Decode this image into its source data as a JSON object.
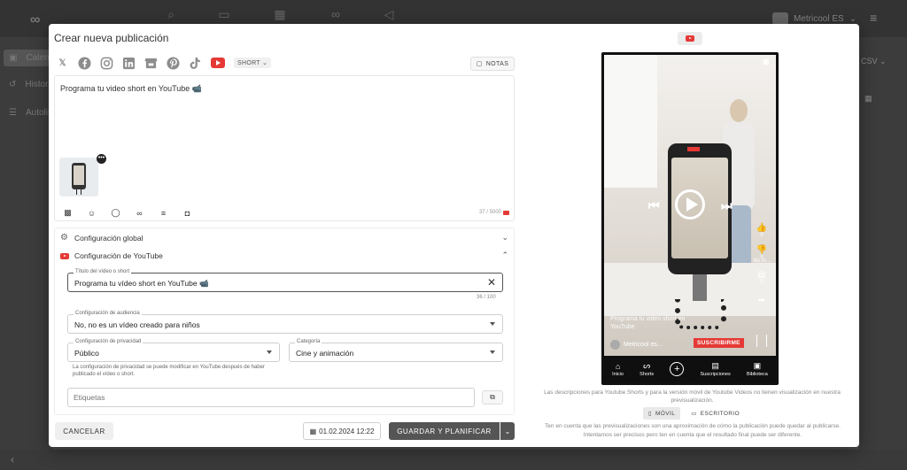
{
  "background": {
    "brand_label": "Metricool ES",
    "sidebar": [
      {
        "label": "Calendario"
      },
      {
        "label": "Historial"
      },
      {
        "label": "Autolistas"
      }
    ],
    "right_export": "CSV"
  },
  "modal": {
    "title": "Crear nueva publicación",
    "networks": [
      "twitter-x",
      "facebook",
      "instagram",
      "linkedin",
      "google-business",
      "pinterest",
      "tiktok",
      "youtube"
    ],
    "short_selector": "SHORT",
    "notes_label": "NOTAS",
    "editor": {
      "text": "Programa tu video short en YouTube 📹",
      "counter": "37 / 5000"
    },
    "global_config_label": "Configuración global",
    "youtube_config_label": "Configuración de YouTube",
    "fields": {
      "video_title": {
        "label": "Título del vídeo o short",
        "value": "Programa tu vídeo short en YouTube 📹",
        "count": "36 / 100"
      },
      "audience": {
        "label": "Configuración de audiencia",
        "value": "No, no es un vídeo creado para niños"
      },
      "privacy": {
        "label": "Configuración de privacidad",
        "value": "Público",
        "helper": "La configuración de privacidad se puede modificar en YouTube después de haber publicado el vídeo o short."
      },
      "category": {
        "label": "Categoría",
        "value": "Cine y animación"
      },
      "tags": {
        "placeholder": "Etiquetas"
      }
    },
    "footer": {
      "cancel_label": "CANCELAR",
      "date_value": "01.02.2024 12:22",
      "save_label": "GUARDAR Y PLANIFICAR"
    }
  },
  "preview": {
    "video_title_overlay": "Programa tu video short en YouTube",
    "channel_name": "Metricool es...",
    "subscribe_label": "SUSCRIBIRME",
    "like_count": "0",
    "dislike_label": "0",
    "more_label": "No m...",
    "comment_count": "0",
    "nav": [
      {
        "label": "Inicio",
        "icon": "home-icon"
      },
      {
        "label": "Shorts",
        "icon": "shorts-icon"
      },
      {
        "label": "",
        "icon": "plus-icon"
      },
      {
        "label": "Suscripciones",
        "icon": "subscriptions-icon"
      },
      {
        "label": "Biblioteca",
        "icon": "library-icon"
      }
    ],
    "note": "Las descripciones para Youtube Shorts y para la versión móvil de Youtube Videos no tienen visualización en nuestra previsualización.",
    "toggle_mobile": "MÓVIL",
    "toggle_desktop": "ESCRITORIO",
    "note2": "Ten en cuenta que las previsualizaciones son una aproximación de cómo la publicación puede quedar al publicarse. Intentamos ser precisos pero ten en cuenta que el resultado final puede ser diferente."
  },
  "colors": {
    "youtube_red": "#e53935",
    "primary_button": "#555555"
  }
}
